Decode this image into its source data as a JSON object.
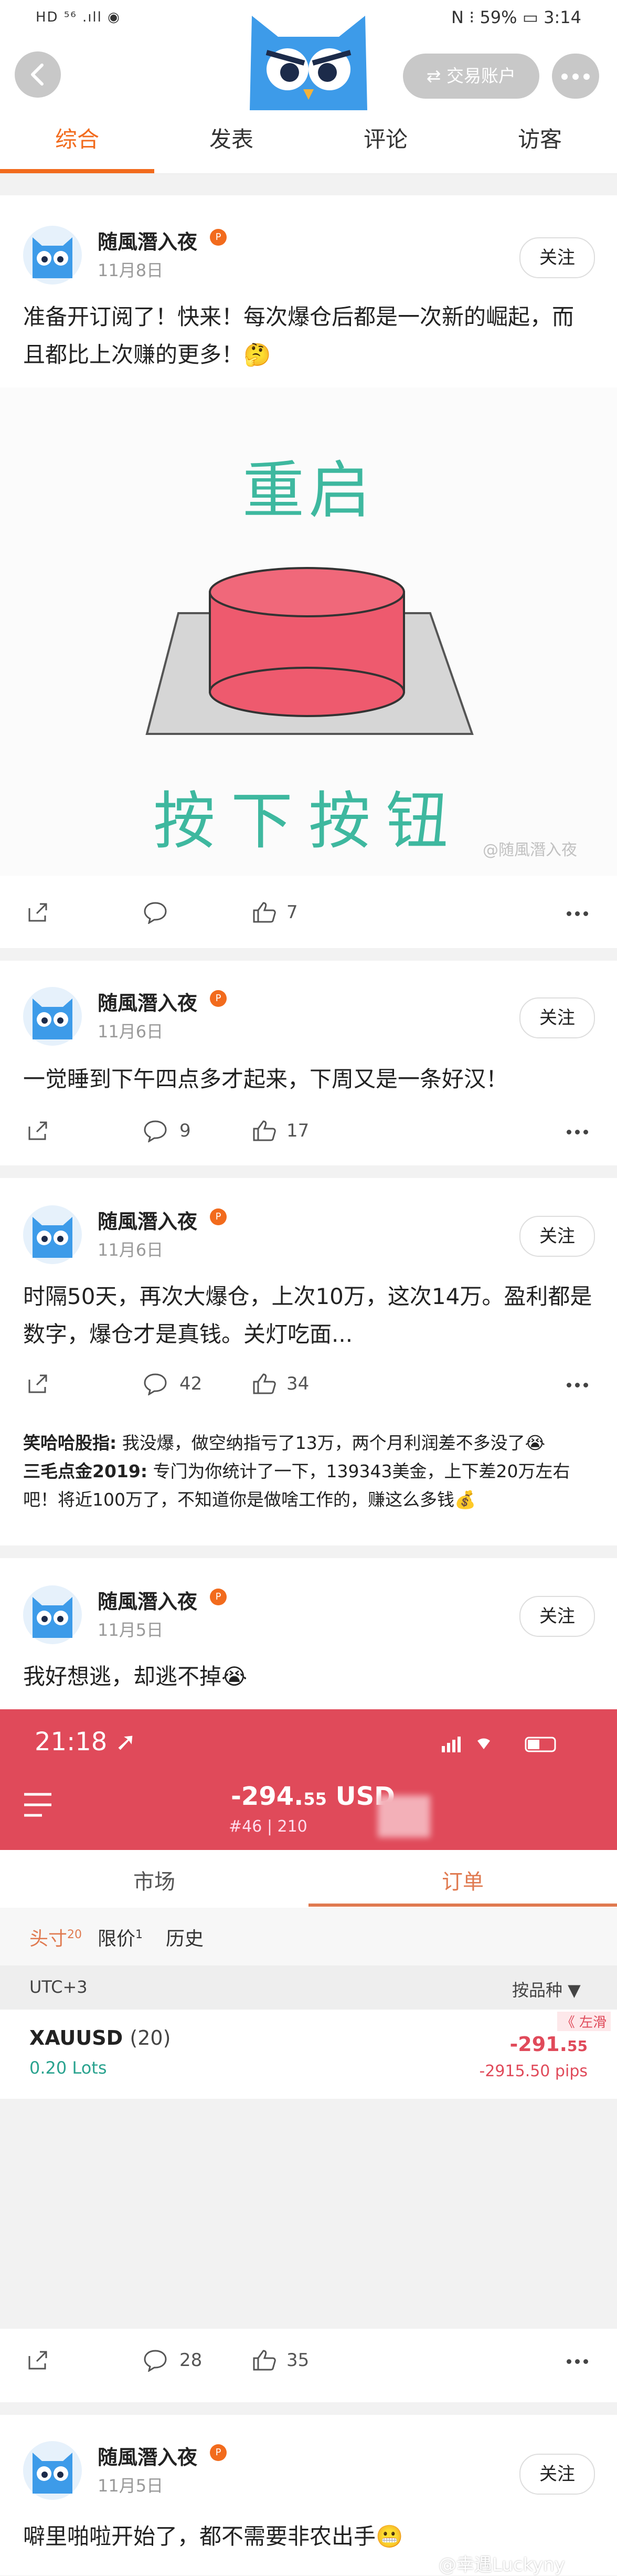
{
  "status_bar": {
    "left": "HD ⁵⁶ .ıll ◉",
    "right": "N ⁝ 59% ▭ 3:14"
  },
  "header": {
    "trade_button": "⇄ 交易账户"
  },
  "tabs": [
    "综合",
    "发表",
    "评论",
    "访客"
  ],
  "colors": {
    "accent": "#f26b1d",
    "shot_red": "#e04a5a"
  },
  "posts": [
    {
      "user": "随風潛入夜",
      "date": "11月8日",
      "follow": "关注",
      "text": "准备开订阅了！快来！每次爆仓后都是一次新的崛起，而且都比上次赚的更多！🤔",
      "image": {
        "title": "重启",
        "caption": "按下按钮",
        "watermark": "@随風潛入夜"
      },
      "actions": {
        "comments": "",
        "likes": "7"
      }
    },
    {
      "user": "随風潛入夜",
      "date": "11月6日",
      "follow": "关注",
      "text": "一觉睡到下午四点多才起来，下周又是一条好汉！",
      "actions": {
        "comments": "9",
        "likes": "17"
      }
    },
    {
      "user": "随風潛入夜",
      "date": "11月6日",
      "follow": "关注",
      "text": "时隔50天，再次大爆仓，上次10万，这次14万。盈利都是数字，爆仓才是真钱。关灯吃面...",
      "actions": {
        "comments": "42",
        "likes": "34"
      },
      "comments": [
        {
          "name": "笑哈哈股指:",
          "text": " 我没爆，做空纳指亏了13万，两个月利润差不多没了😭"
        },
        {
          "name": "三毛点金2019:",
          "text": " 专门为你统计了一下，139343美金，上下差20万左右吧！将近100万了，不知道你是做啥工作的，赚这么多钱💰"
        }
      ]
    },
    {
      "user": "随風潛入夜",
      "date": "11月5日",
      "follow": "关注",
      "text": "我好想逃，却逃不掉😭",
      "screenshot": {
        "time": "21:18 ➚",
        "amount_main": "-294.",
        "amount_dec": "55",
        "currency": " USD",
        "sub": "#46 | 210",
        "tabs": [
          "市场",
          "订单"
        ],
        "filters": [
          {
            "label": "头寸",
            "count": "20"
          },
          {
            "label": "限价",
            "count": "1"
          },
          {
            "label": "历史",
            "count": ""
          }
        ],
        "timezone": "UTC+3",
        "sort_label": "按品种 ▼",
        "order": {
          "symbol": "XAUUSD",
          "count": "(20)",
          "lots": "0.20 Lots",
          "pnl_main": "-291.",
          "pnl_dec": "55",
          "pips": "-2915.50 pips",
          "slide": "《 左滑"
        }
      },
      "actions": {
        "comments": "28",
        "likes": "35"
      }
    },
    {
      "user": "随風潛入夜",
      "date": "11月5日",
      "follow": "关注",
      "text": "噼里啪啦开始了，都不需要非农出手😬"
    }
  ],
  "bottom_watermark": "@幸遇Luckyny"
}
